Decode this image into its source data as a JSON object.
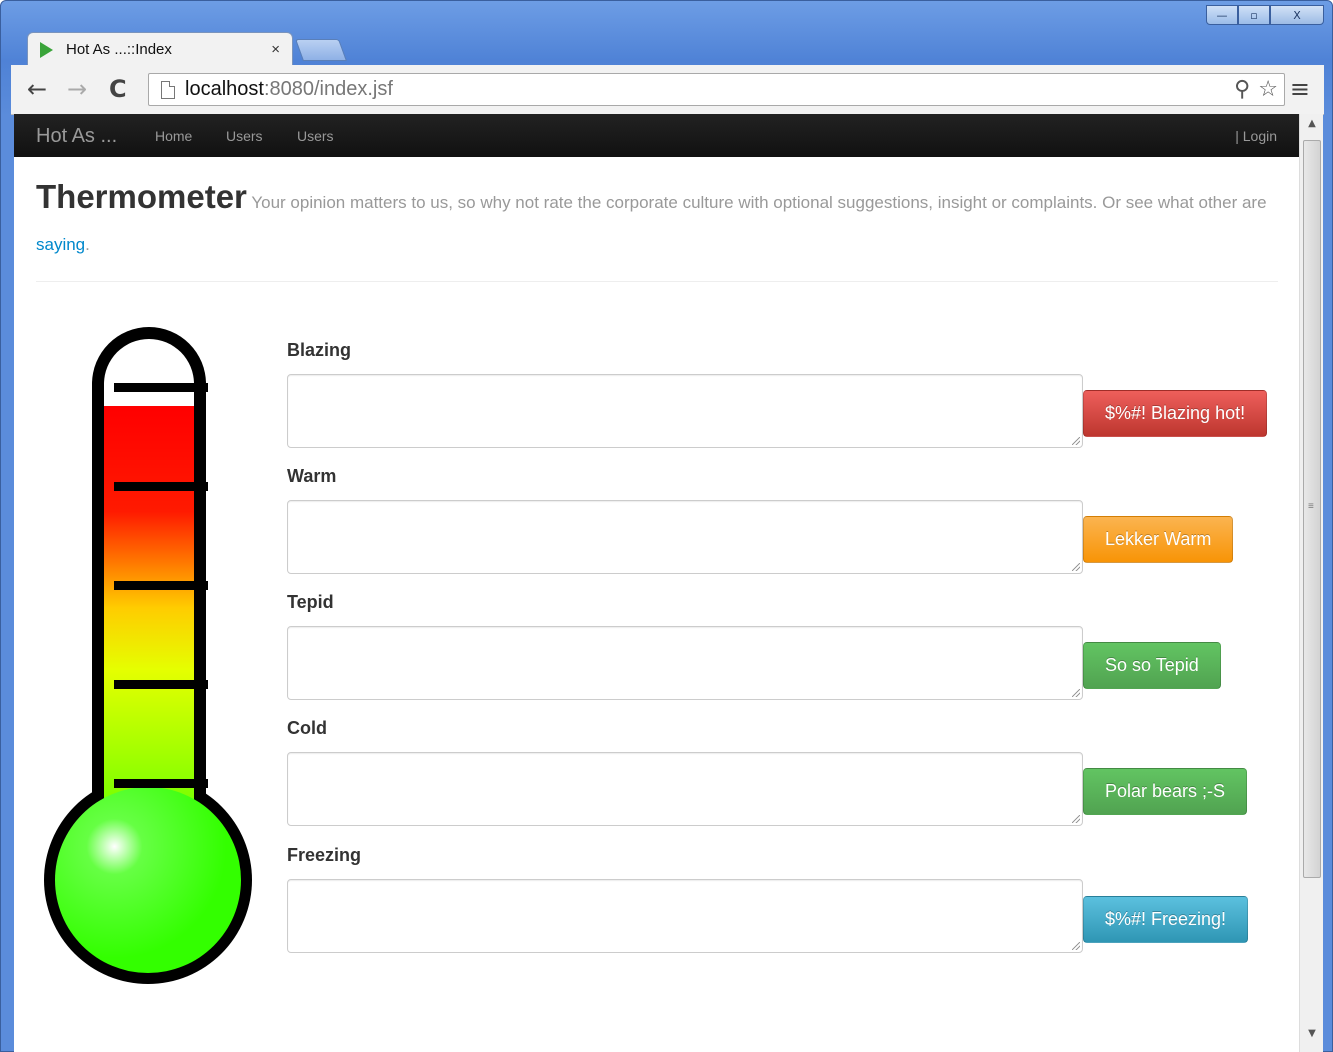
{
  "browser": {
    "tab_title": "Hot As ...::Index",
    "tab_close": "×",
    "url_host": "localhost",
    "url_rest": ":8080/index.jsf",
    "window_controls": {
      "minimize": "—",
      "maximize": "▫",
      "close": "X"
    }
  },
  "navbar": {
    "brand": "Hot As ...",
    "links": [
      "Home",
      "Users",
      "Users"
    ],
    "login": "| Login"
  },
  "header": {
    "title": "Thermometer",
    "subtitle_before": "Your opinion matters to us, so why not rate the corporate culture with optional suggestions, insight or complaints. Or see what other are ",
    "subtitle_link": "saying",
    "subtitle_after": "."
  },
  "levels": [
    {
      "label": "Blazing",
      "button": "$%#! Blazing hot!",
      "style": "danger",
      "value": ""
    },
    {
      "label": "Warm",
      "button": "Lekker Warm",
      "style": "warning",
      "value": ""
    },
    {
      "label": "Tepid",
      "button": "So so Tepid",
      "style": "success",
      "value": ""
    },
    {
      "label": "Cold",
      "button": "Polar bears ;-S",
      "style": "success",
      "value": ""
    },
    {
      "label": "Freezing",
      "button": "$%#! Freezing!",
      "style": "info",
      "value": ""
    }
  ],
  "colors": {
    "danger": "#da4f49",
    "warning": "#faa732",
    "success": "#5bb75b",
    "info": "#49afcd",
    "thermo_hot": "#ff0000",
    "thermo_mid": "#e5ff00",
    "thermo_cold": "#33ff00"
  }
}
